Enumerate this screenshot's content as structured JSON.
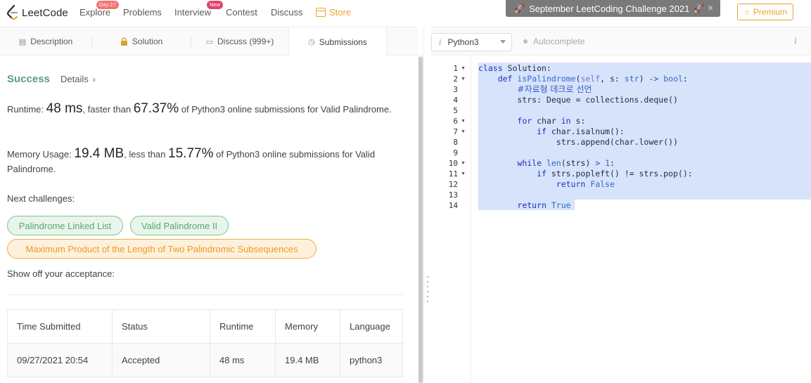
{
  "topnav": {
    "logo_text": "LeetCode",
    "items": [
      {
        "label": "Explore",
        "badge": "Day 27"
      },
      {
        "label": "Problems"
      },
      {
        "label": "Interview",
        "badge": "New"
      },
      {
        "label": "Contest"
      },
      {
        "label": "Discuss"
      },
      {
        "label": "Store"
      }
    ],
    "banner": "September LeetCoding Challenge 2021",
    "premium_label": "Premium",
    "colors": {
      "store": "#f0a22e",
      "premium": "#f0a22e",
      "badge_day": "#f5746f",
      "badge_new": "#e0436a"
    }
  },
  "tabs": [
    {
      "label": "Description",
      "icon": "document-icon"
    },
    {
      "label": "Solution",
      "icon": "lock-icon"
    },
    {
      "label": "Discuss (999+)",
      "icon": "comment-icon"
    },
    {
      "label": "Submissions",
      "icon": "clock-icon",
      "active": true
    }
  ],
  "result": {
    "status": "Success",
    "details_label": "Details",
    "runtime": {
      "label": "Runtime:",
      "value": "48 ms",
      "faster_than": ", faster than",
      "percent": "67.37%",
      "suffix": "of Python3 online submissions for Valid Palindrome."
    },
    "memory": {
      "label": "Memory Usage:",
      "value": "19.4 MB",
      "less_than": ", less than",
      "percent": "15.77%",
      "suffix": "of Python3 online submissions for Valid Palindrome."
    },
    "next_challenges_label": "Next challenges:",
    "challenges": [
      {
        "label": "Palindrome Linked List",
        "difficulty": "easy"
      },
      {
        "label": "Valid Palindrome II",
        "difficulty": "easy"
      },
      {
        "label": "Maximum Product of the Length of Two Palindromic Subsequences",
        "difficulty": "medium"
      }
    ],
    "show_off_label": "Show off your acceptance:",
    "colors": {
      "success": "#5a9e7c",
      "easy": "#57a96d",
      "medium": "#ef9a21"
    }
  },
  "submissions_table": {
    "headers": [
      "Time Submitted",
      "Status",
      "Runtime",
      "Memory",
      "Language"
    ],
    "rows": [
      [
        "09/27/2021 20:54",
        "Accepted",
        "48 ms",
        "19.4 MB",
        "python3"
      ]
    ]
  },
  "editor": {
    "language": "Python3",
    "autocomplete_label": "Autocomplete",
    "line_numbers": [
      "1",
      "2",
      "3",
      "4",
      "5",
      "6",
      "7",
      "8",
      "9",
      "10",
      "11",
      "12",
      "13",
      "14"
    ],
    "code_lines": [
      "class Solution:",
      "    def isPalindrome(self, s: str) -> bool:",
      "        #자료형 데크로 선언",
      "        strs: Deque = collections.deque()",
      "",
      "        for char in s:",
      "            if char.isalnum():",
      "                strs.append(char.lower())",
      "",
      "        while len(strs) > 1:",
      "            if strs.popleft() != strs.pop():",
      "                return False",
      "",
      "        return True"
    ]
  }
}
